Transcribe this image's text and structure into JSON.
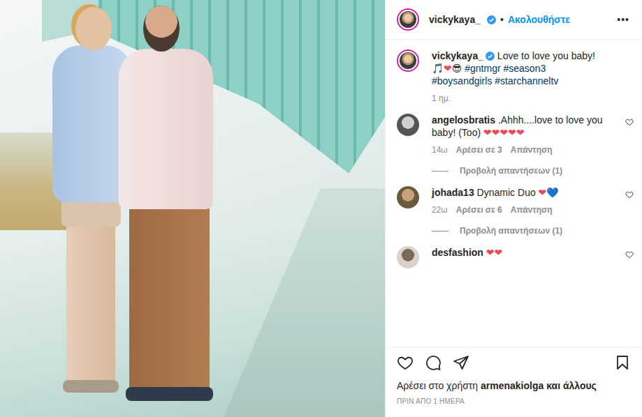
{
  "header": {
    "username": "vickykaya_",
    "verified": true,
    "separator": "•",
    "follow": "Ακολουθήστε",
    "more": "•••"
  },
  "caption": {
    "username": "vickykaya_",
    "verified": true,
    "text": "Love to love you baby!",
    "emojis": "🎵❤😎",
    "hashtags": [
      "#gntmgr",
      "#season3",
      "#boysandgirls",
      "#starchanneltv"
    ],
    "time": "1 ημ."
  },
  "comments": [
    {
      "username": "angelosbratis",
      "text": ".Ahhh....love to love you baby! (Too) ❤❤❤❤❤",
      "time": "14ω",
      "likes": "Αρέσει σε 3",
      "reply": "Απάντηση",
      "view_replies": "Προβολή απαντήσεων (1)",
      "liked": false
    },
    {
      "username": "johada13",
      "text": "Dynamic Duo ❤💙",
      "time": "22ω",
      "likes": "Αρέσει σε 6",
      "reply": "Απάντηση",
      "view_replies": "Προβολή απαντήσεων (1)",
      "liked": false
    },
    {
      "username": "desfashion",
      "text": "❤❤",
      "liked": false
    }
  ],
  "actions": {
    "liked": false,
    "saved": false
  },
  "likes": {
    "prefix": "Αρέσει στο χρήστη",
    "user": "armenakiolga",
    "suffix": "και άλλους"
  },
  "timestamp": "ΠΡΙΝ ΑΠΟ 1 ΗΜΕΡΑ"
}
